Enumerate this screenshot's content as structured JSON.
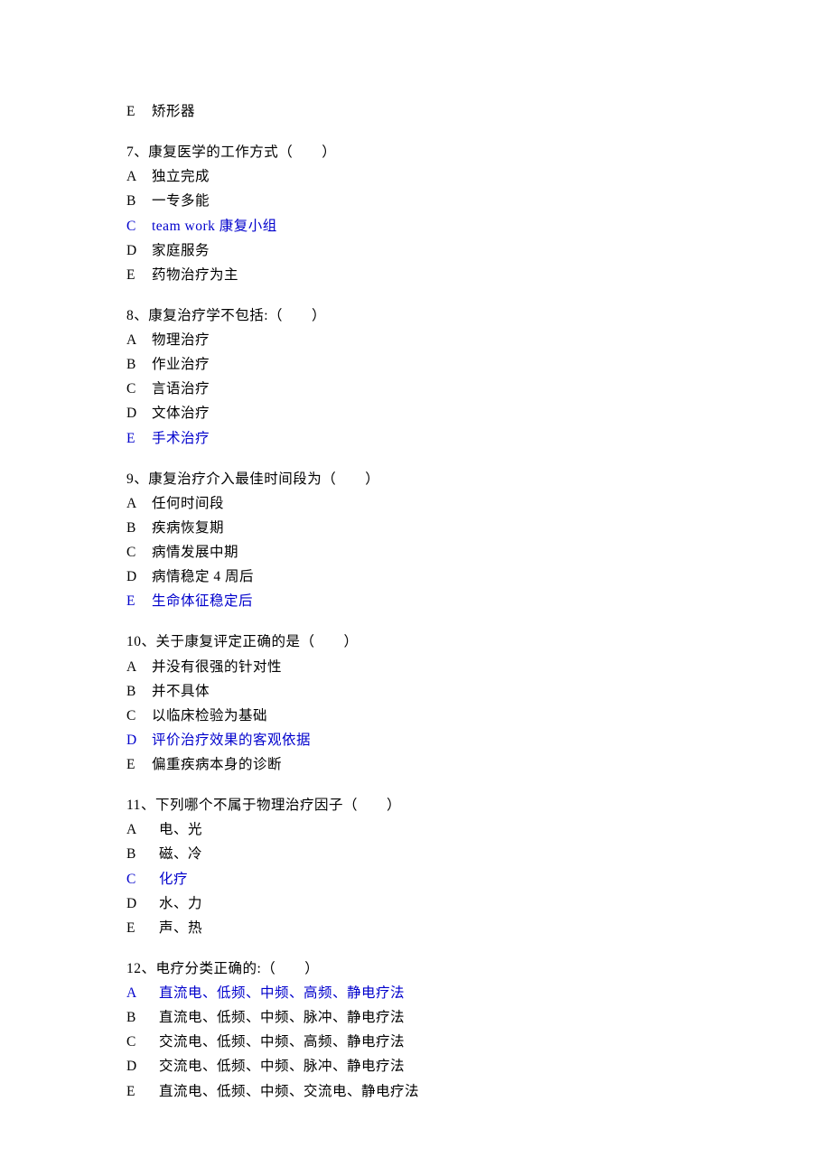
{
  "orphan": {
    "letter": "E",
    "text": "矫形器"
  },
  "questions": [
    {
      "num": "7",
      "stem": "、康复医学的工作方式（　　）",
      "options": [
        {
          "letter": "A",
          "text": "独立完成",
          "answer": false
        },
        {
          "letter": "B",
          "text": "一专多能",
          "answer": false
        },
        {
          "letter": "C",
          "text": "team work 康复小组",
          "answer": true,
          "latinPrefix": "team work ",
          "cn": "康复小组"
        },
        {
          "letter": "D",
          "text": "家庭服务",
          "answer": false
        },
        {
          "letter": "E",
          "text": "药物治疗为主",
          "answer": false
        }
      ]
    },
    {
      "num": "8",
      "stem": "、康复治疗学不包括:（　　）",
      "options": [
        {
          "letter": "A",
          "text": "物理治疗",
          "answer": false
        },
        {
          "letter": "B",
          "text": "作业治疗",
          "answer": false
        },
        {
          "letter": "C",
          "text": "言语治疗",
          "answer": false
        },
        {
          "letter": "D",
          "text": "文体治疗",
          "answer": false
        },
        {
          "letter": "E",
          "text": "手术治疗",
          "answer": true
        }
      ]
    },
    {
      "num": "9",
      "stem": "、康复治疗介入最佳时间段为（　　）",
      "options": [
        {
          "letter": "A",
          "text": "任何时间段",
          "answer": false
        },
        {
          "letter": "B",
          "text": "疾病恢复期",
          "answer": false
        },
        {
          "letter": "C",
          "text": "病情发展中期",
          "answer": false
        },
        {
          "letter": "D",
          "text": "病情稳定 4 周后",
          "answer": false
        },
        {
          "letter": "E",
          "text": "生命体征稳定后",
          "answer": true
        }
      ]
    },
    {
      "num": "10",
      "stem": "、关于康复评定正确的是（　　）",
      "options": [
        {
          "letter": "A",
          "text": "并没有很强的针对性",
          "answer": false
        },
        {
          "letter": "B",
          "text": "并不具体",
          "answer": false
        },
        {
          "letter": "C",
          "text": "以临床检验为基础",
          "answer": false
        },
        {
          "letter": "D",
          "text": "评价治疗效果的客观依据",
          "answer": true
        },
        {
          "letter": "E",
          "text": "偏重疾病本身的诊断",
          "answer": false
        }
      ]
    },
    {
      "num": "11",
      "stem": "、下列哪个不属于物理治疗因子（　　）",
      "options": [
        {
          "letter": "A",
          "text": "电、光",
          "answer": false,
          "wide": true
        },
        {
          "letter": "B",
          "text": "磁、冷",
          "answer": false,
          "wide": true
        },
        {
          "letter": "C",
          "text": "化疗",
          "answer": true,
          "wide": true
        },
        {
          "letter": "D",
          "text": "水、力",
          "answer": false,
          "wide": true
        },
        {
          "letter": "E",
          "text": "声、热",
          "answer": false,
          "wide": true
        }
      ]
    },
    {
      "num": "12",
      "stem": "、电疗分类正确的:（　　）",
      "options": [
        {
          "letter": "A",
          "text": "直流电、低频、中频、高频、静电疗法",
          "answer": true,
          "wide": true
        },
        {
          "letter": "B",
          "text": "直流电、低频、中频、脉冲、静电疗法",
          "answer": false,
          "wide": true
        },
        {
          "letter": "C",
          "text": "交流电、低频、中频、高频、静电疗法",
          "answer": false,
          "wide": true
        },
        {
          "letter": "D",
          "text": "交流电、低频、中频、脉冲、静电疗法",
          "answer": false,
          "wide": true
        },
        {
          "letter": "E",
          "text": "直流电、低频、中频、交流电、静电疗法",
          "answer": false,
          "wide": true
        }
      ]
    }
  ]
}
